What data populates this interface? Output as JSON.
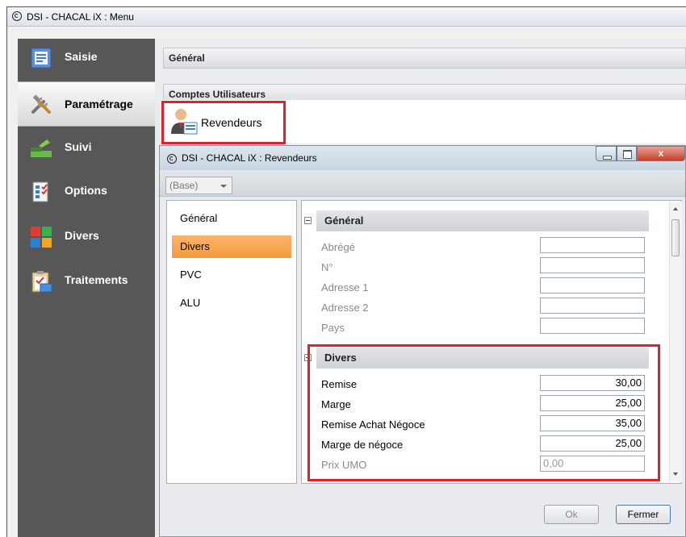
{
  "main_window": {
    "title": "DSI - CHACAL iX : Menu"
  },
  "sidebar": {
    "items": [
      {
        "label": "Saisie",
        "icon": "form-icon"
      },
      {
        "label": "Paramétrage",
        "icon": "tools-icon",
        "active": true
      },
      {
        "label": "Suivi",
        "icon": "tracking-icon"
      },
      {
        "label": "Options",
        "icon": "options-icon"
      },
      {
        "label": "Divers",
        "icon": "tiles-icon"
      },
      {
        "label": "Traitements",
        "icon": "clipboard-icon"
      }
    ]
  },
  "content": {
    "sections": [
      "Général",
      "Comptes Utilisateurs"
    ],
    "reseller_item": "Revendeurs"
  },
  "child_window": {
    "title": "DSI - CHACAL iX : Revendeurs",
    "close_glyph": "x",
    "dropdown_value": "(Base)",
    "categories": [
      "Général",
      "Divers",
      "PVC",
      "ALU"
    ],
    "selected_category": "Divers",
    "grid": {
      "general_header": "Général",
      "general_fields": [
        {
          "label": "Abrégé",
          "value": ""
        },
        {
          "label": "N°",
          "value": ""
        },
        {
          "label": "Adresse 1",
          "value": ""
        },
        {
          "label": "Adresse 2",
          "value": ""
        },
        {
          "label": "Pays",
          "value": ""
        }
      ],
      "divers_header": "Divers",
      "divers_fields": [
        {
          "label": "Remise",
          "value": "30,00"
        },
        {
          "label": "Marge",
          "value": "25,00"
        },
        {
          "label": "Remise Achat  Négoce",
          "value": "35,00"
        },
        {
          "label": "Marge de négoce",
          "value": "25,00"
        },
        {
          "label": "Prix UMO",
          "value": "0,00"
        }
      ]
    },
    "buttons": {
      "ok": "Ok",
      "close": "Fermer"
    }
  },
  "colors": {
    "highlight": "#e0202a",
    "selected": "#f59a3f",
    "sidebar_bg": "#575757"
  }
}
